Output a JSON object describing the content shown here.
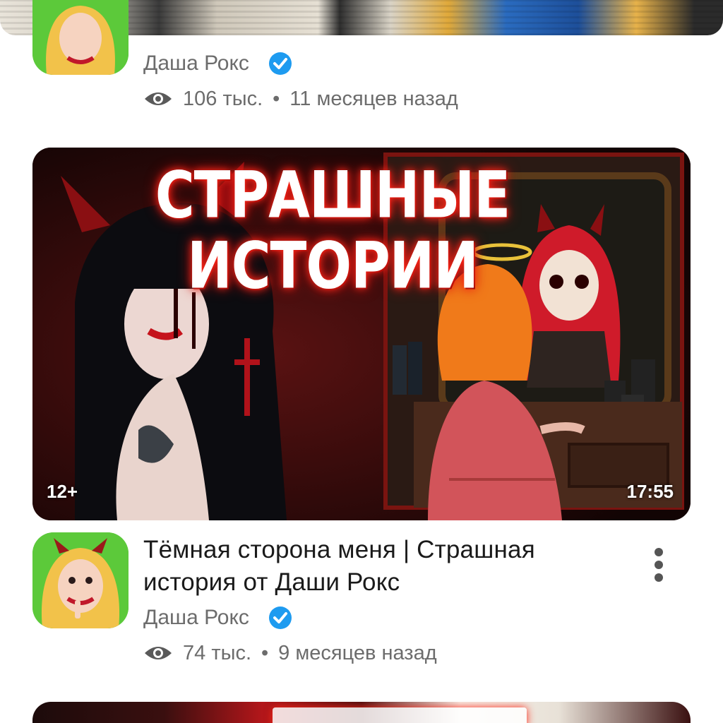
{
  "video_prev": {
    "channel_name": "Даша Рокс",
    "views": "106 тыс.",
    "separator": "•",
    "age": "11 месяцев назад"
  },
  "video_main": {
    "thumbnail_caption_line1": "СТРАШНЫЕ",
    "thumbnail_caption_line2": "ИСТОРИИ",
    "age_rating": "12+",
    "duration": "17:55",
    "title": "Тёмная сторона меня | Страшная история от Даши Рокс",
    "channel_name": "Даша Рокс",
    "views": "74 тыс.",
    "separator": "•",
    "age": "9 месяцев назад"
  },
  "icons": {
    "verified": "verified-badge-icon",
    "views": "eye-icon",
    "more": "more-vertical-icon"
  },
  "colors": {
    "verified_blue": "#1e9bf0",
    "meta_gray": "#6c6c6c",
    "avatar_green": "#5cc93a",
    "caption_glow": "#ff2a1a"
  }
}
